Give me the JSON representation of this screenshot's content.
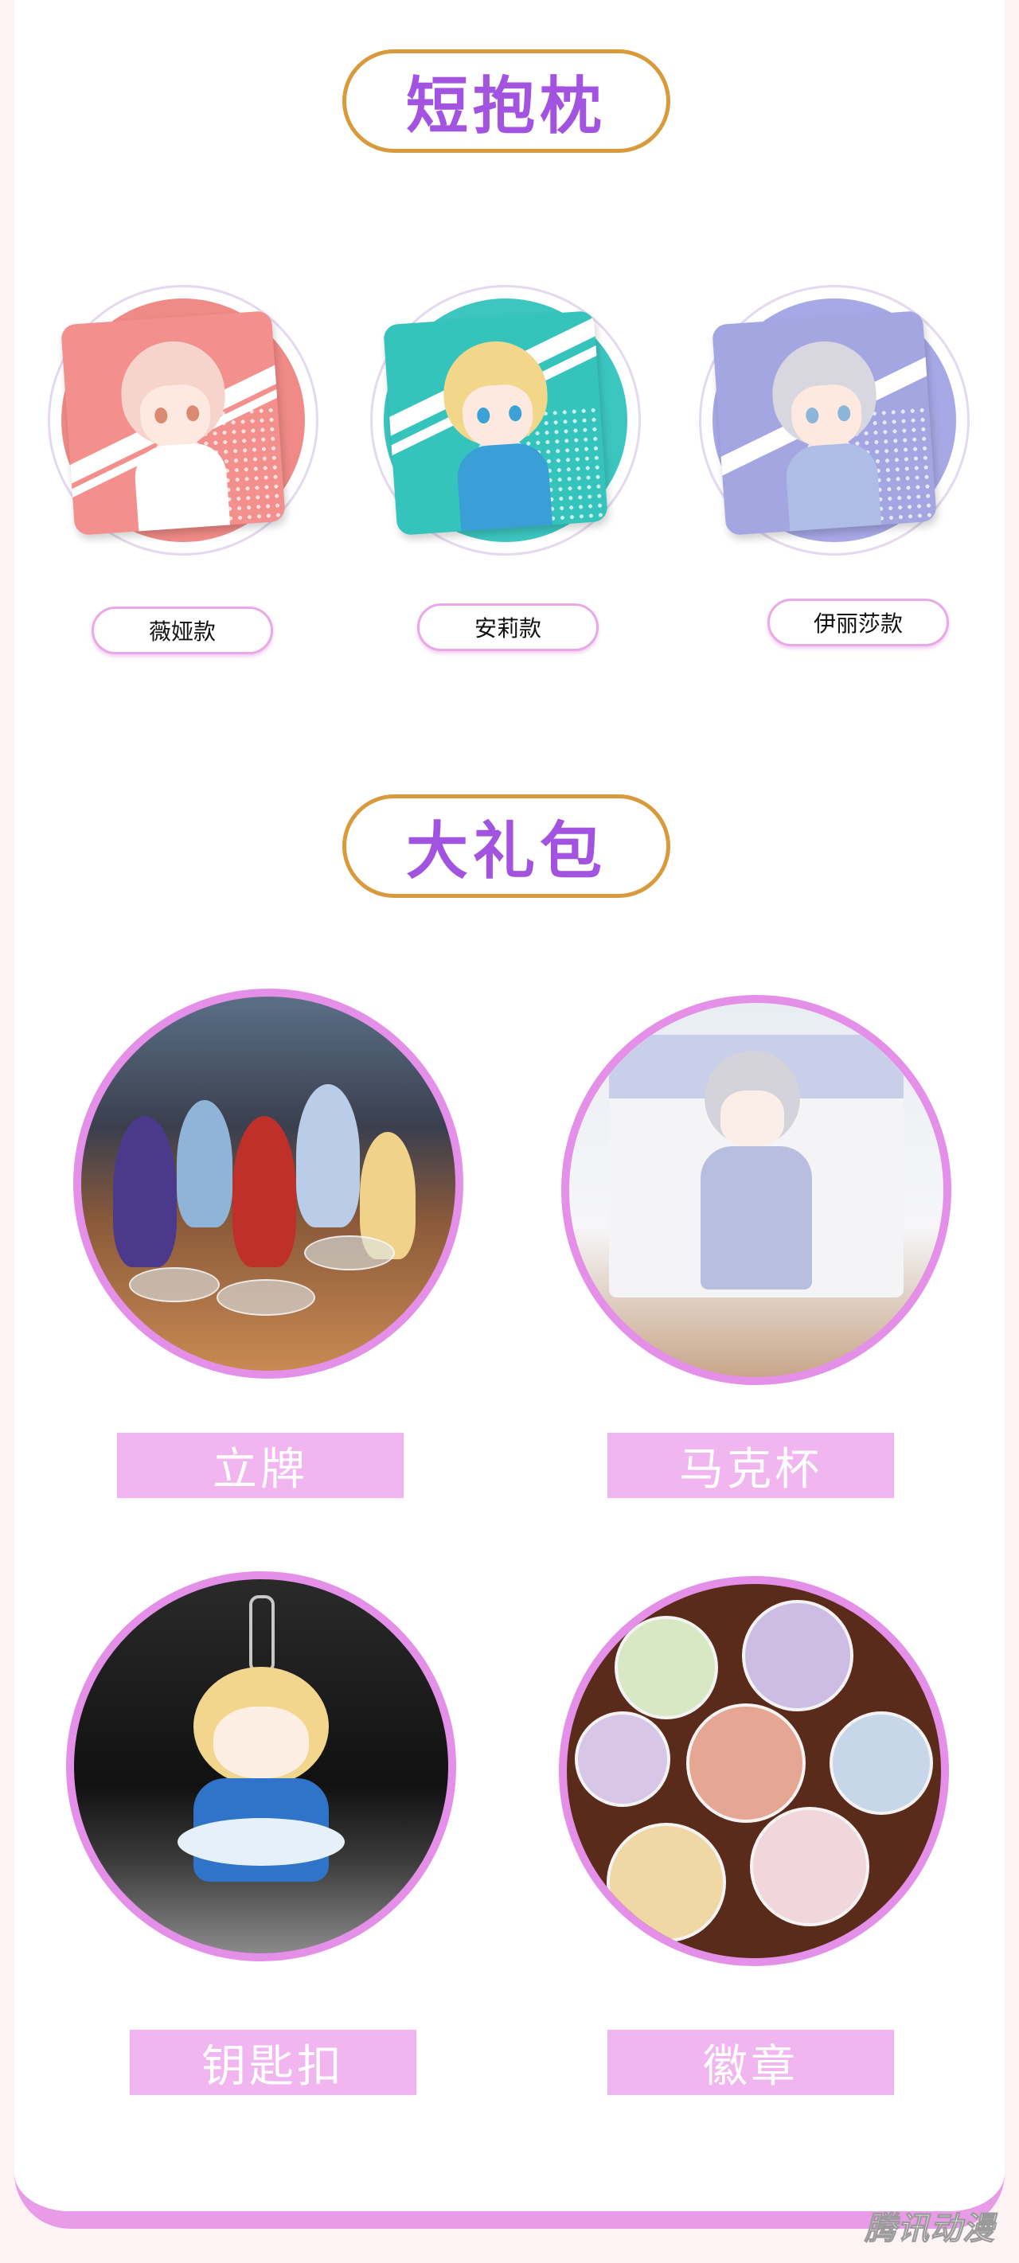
{
  "sections": [
    {
      "title": "短抱枕"
    },
    {
      "title": "大礼包"
    }
  ],
  "pillows": [
    {
      "label": "薇娅款",
      "circle_color": "#f08a86",
      "pillow_color": "#f3908d",
      "hair_color": "#f6d4cc",
      "body_color": "#ffffff",
      "eye_color": "#d98a70"
    },
    {
      "label": "安莉款",
      "circle_color": "#3cc6c0",
      "pillow_color": "#35c4bc",
      "hair_color": "#f2d68a",
      "body_color": "#3a9fd6",
      "eye_color": "#3aa2d4"
    },
    {
      "label": "伊丽莎款",
      "circle_color": "#a7a8e6",
      "pillow_color": "#a4a6e2",
      "hair_color": "#d8d6de",
      "body_color": "#aebde6",
      "eye_color": "#8cb6d8"
    }
  ],
  "gifts": [
    {
      "label": "立牌"
    },
    {
      "label": "马克杯"
    },
    {
      "label": "钥匙扣"
    },
    {
      "label": "徽章"
    }
  ],
  "watermark": "腾讯动漫",
  "colors": {
    "accent_purple": "#a253e0",
    "pill_border": "#d89a3a",
    "label_bg": "#f1b5f0",
    "circle_border": "#e48fe8"
  }
}
